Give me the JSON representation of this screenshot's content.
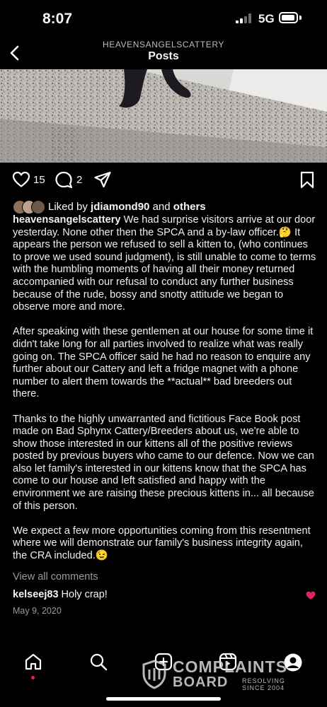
{
  "status_bar": {
    "time": "8:07",
    "network": "5G"
  },
  "header": {
    "account": "HEAVENSANGELSCATTERY",
    "title": "Posts"
  },
  "post": {
    "likes_count": "15",
    "comments_count": "2",
    "liked_by_prefix": "Liked by ",
    "liked_by_user": "jdiamond90",
    "liked_by_and": " and ",
    "liked_by_others": "others",
    "author": "heavensangelscattery",
    "caption_p1": "We had surprise visitors arrive at our door yesterday.  None other then the SPCA and a by-law officer.🤔 It appears the person we refused to sell a kitten to, (who continues to prove we used sound judgment), is still unable to come to terms with the humbling moments of having all their money returned accompanied with our refusal to conduct any further business because of the rude, bossy and snotty attitude we began to observe more and more.",
    "caption_p2": "After speaking with these gentlemen at our house for some time it didn't take long for all parties involved to realize what was really going on.  The SPCA officer said he had no reason to enquire any further about our Cattery and left a fridge magnet with a phone number to alert them towards the **actual** bad breeders out there.",
    "caption_p3": "Thanks to the highly unwarranted and fictitious Face Book post made on Bad Sphynx Cattery/Breeders about us, we're able to show those interested in our kittens all of the positive reviews posted by previous buyers who came to our defence. Now we can also let family's interested in our kittens know that the SPCA has come to our house and left satisfied and happy with the environment we are raising these precious kittens in... all because of this person.",
    "caption_p4": "We expect a few more opportunities coming from this resentment where we will demonstrate our family's business integrity again, the CRA included.😉",
    "view_comments": "View all comments",
    "comment_user": "kelseej83",
    "comment_text": " Holy crap!",
    "date": "May 9, 2020"
  },
  "watermark": {
    "line1": "COMPLAINTS",
    "line2": "BOARD",
    "line3a": "RESOLVING",
    "line3b": "SINCE 2004"
  },
  "colors": {
    "background": "#000000",
    "text": "#f5f5f5",
    "muted": "#9a9a9a",
    "like_heart": "#e0245e"
  },
  "icons": [
    "back-arrow",
    "heart",
    "comment",
    "share",
    "bookmark",
    "home",
    "search",
    "create",
    "reels",
    "profile"
  ]
}
